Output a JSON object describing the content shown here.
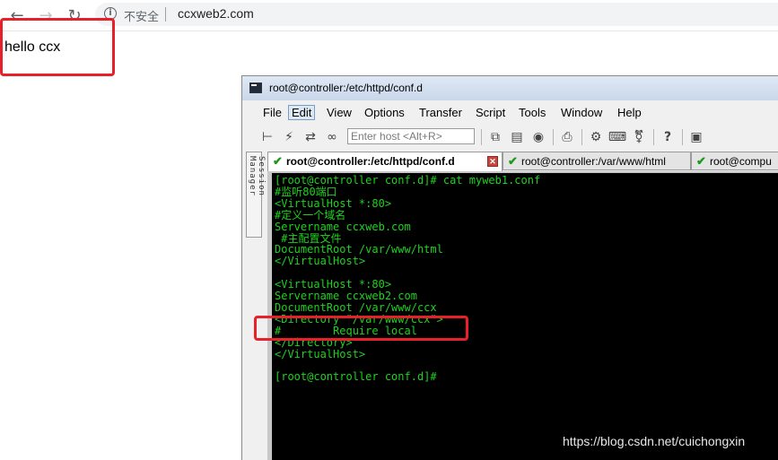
{
  "browser": {
    "insecure_label": "不安全",
    "url": "ccxweb2.com",
    "page_text": "hello ccx"
  },
  "securecrt": {
    "window_title": "root@controller:/etc/httpd/conf.d",
    "menu": [
      "File",
      "Edit",
      "View",
      "Options",
      "Transfer",
      "Script",
      "Tools",
      "Window",
      "Help"
    ],
    "host_placeholder": "Enter host <Alt+R>",
    "session_manager_label": "Session Manager",
    "tabs": [
      {
        "label": "root@controller:/etc/httpd/conf.d"
      },
      {
        "label": "root@controller:/var/www/html"
      },
      {
        "label": "root@compu"
      }
    ],
    "terminal_lines": [
      "[root@controller conf.d]# cat myweb1.conf",
      "#监听80端口",
      "<VirtualHost *:80>",
      "#定义一个域名",
      "Servername ccxweb.com",
      " #主配置文件",
      "DocumentRoot /var/www/html",
      "</VirtualHost>",
      "",
      "<VirtualHost *:80>",
      "Servername ccxweb2.com",
      "DocumentRoot /var/www/ccx",
      "<Directory \"/var/www/ccx\">",
      "#        Require local",
      "</Directory>",
      "</VirtualHost>",
      "",
      "[root@controller conf.d]#"
    ]
  },
  "watermark": "https://blog.csdn.net/cuichongxin",
  "colors": {
    "terminal_fg": "#1fd21f",
    "terminal_bg": "#000000",
    "highlight": "#e8202a"
  }
}
